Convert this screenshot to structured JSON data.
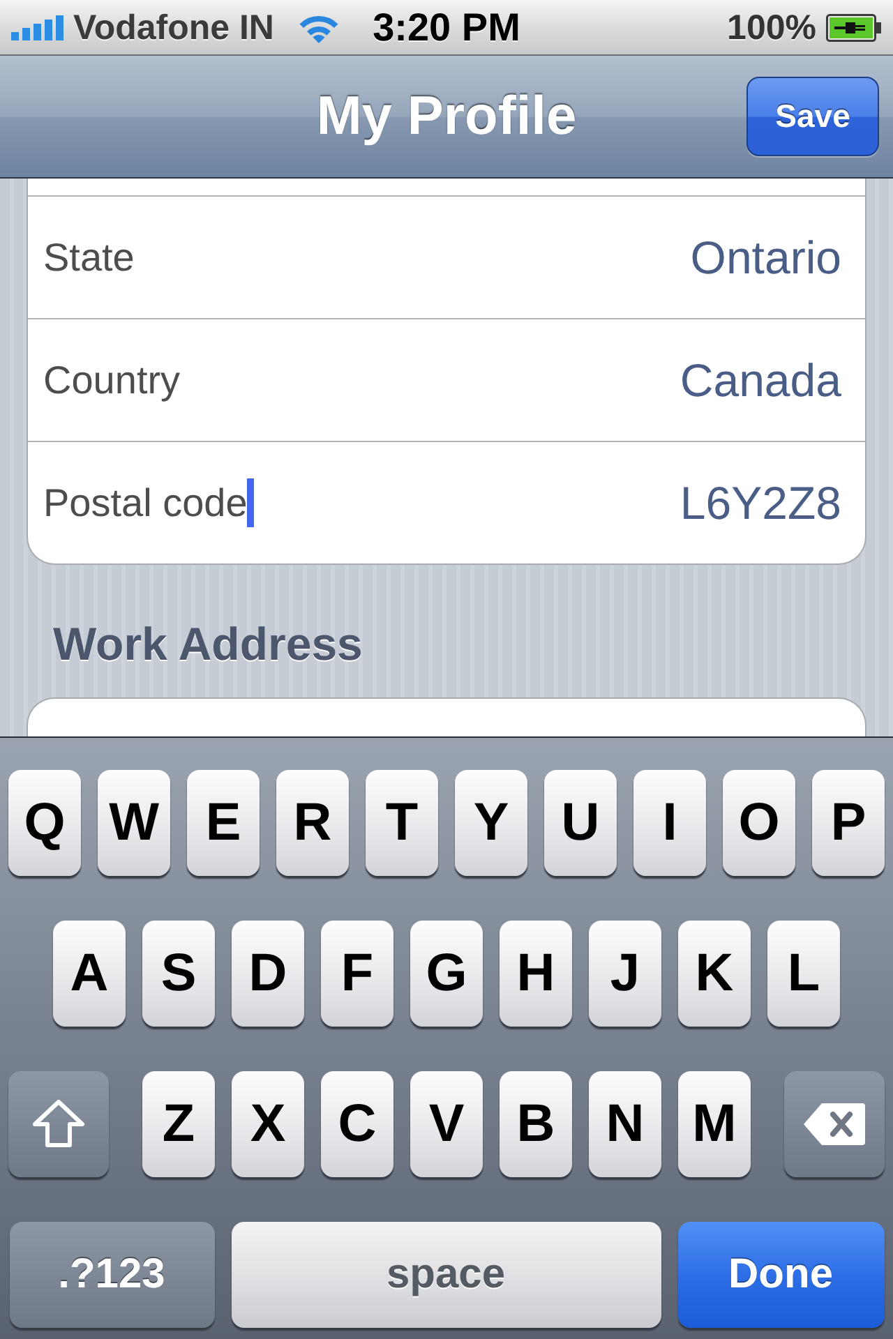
{
  "status_bar": {
    "carrier": "Vodafone IN",
    "time": "3:20 PM",
    "battery": "100%"
  },
  "nav_bar": {
    "title": "My Profile",
    "button": "Save"
  },
  "form": {
    "sections": [
      {
        "rows": [
          {
            "label": "State",
            "value": "Ontario",
            "focused": false
          },
          {
            "label": "Country",
            "value": "Canada",
            "focused": false
          },
          {
            "label": "Postal code",
            "value": "L6Y2Z8",
            "focused": true
          }
        ]
      },
      {
        "header": "Work Address"
      }
    ]
  },
  "keyboard": {
    "rows": [
      {
        "keys": [
          {
            "kind": "letter",
            "label": "Q"
          },
          {
            "kind": "letter",
            "label": "W"
          },
          {
            "kind": "letter",
            "label": "E"
          },
          {
            "kind": "letter",
            "label": "R"
          },
          {
            "kind": "letter",
            "label": "T"
          },
          {
            "kind": "letter",
            "label": "Y"
          },
          {
            "kind": "letter",
            "label": "U"
          },
          {
            "kind": "letter",
            "label": "I"
          },
          {
            "kind": "letter",
            "label": "O"
          },
          {
            "kind": "letter",
            "label": "P"
          }
        ]
      },
      {
        "keys": [
          {
            "kind": "letter",
            "label": "A"
          },
          {
            "kind": "letter",
            "label": "S"
          },
          {
            "kind": "letter",
            "label": "D"
          },
          {
            "kind": "letter",
            "label": "F"
          },
          {
            "kind": "letter",
            "label": "G"
          },
          {
            "kind": "letter",
            "label": "H"
          },
          {
            "kind": "letter",
            "label": "J"
          },
          {
            "kind": "letter",
            "label": "K"
          },
          {
            "kind": "letter",
            "label": "L"
          }
        ]
      },
      {
        "keys": [
          {
            "kind": "shift"
          },
          {
            "kind": "letter",
            "label": "Z"
          },
          {
            "kind": "letter",
            "label": "X"
          },
          {
            "kind": "letter",
            "label": "C"
          },
          {
            "kind": "letter",
            "label": "V"
          },
          {
            "kind": "letter",
            "label": "B"
          },
          {
            "kind": "letter",
            "label": "N"
          },
          {
            "kind": "letter",
            "label": "M"
          },
          {
            "kind": "delete"
          }
        ]
      },
      {
        "keys": [
          {
            "kind": "mode",
            "label": ".?123"
          },
          {
            "kind": "space",
            "label": "space"
          },
          {
            "kind": "done",
            "label": "Done"
          }
        ]
      }
    ]
  }
}
